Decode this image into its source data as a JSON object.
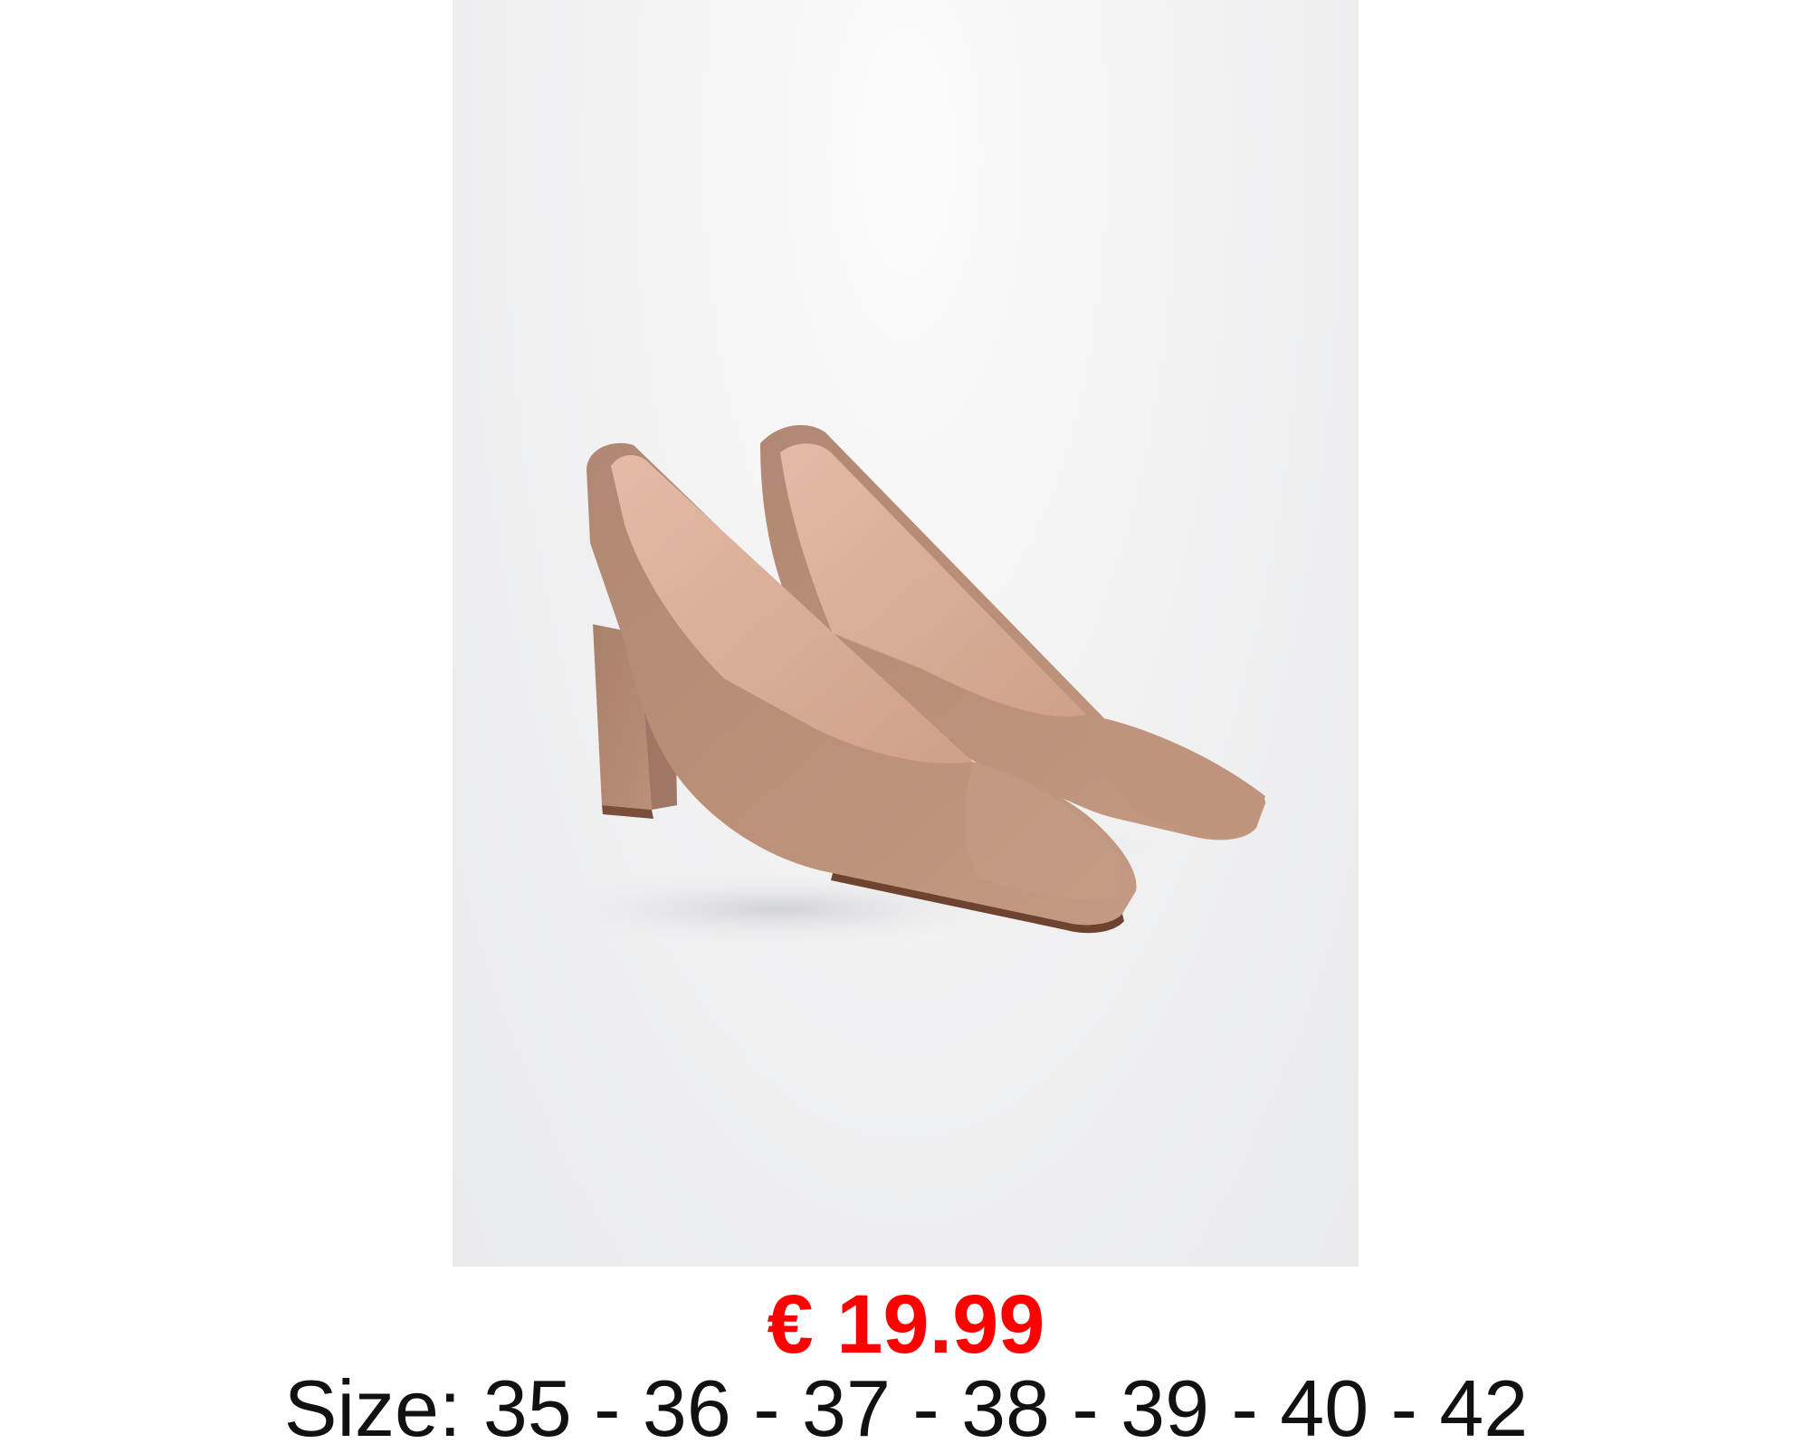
{
  "product": {
    "image_alt": "Tan suede block-heel pumps",
    "price": "€ 19.99",
    "sizes": "Size: 35 - 36 - 37 - 38 - 39 - 40 - 42"
  },
  "colors": {
    "price": "#ff0000",
    "text": "#111111",
    "suede": "#b98c74",
    "lining": "#d6ab95"
  }
}
